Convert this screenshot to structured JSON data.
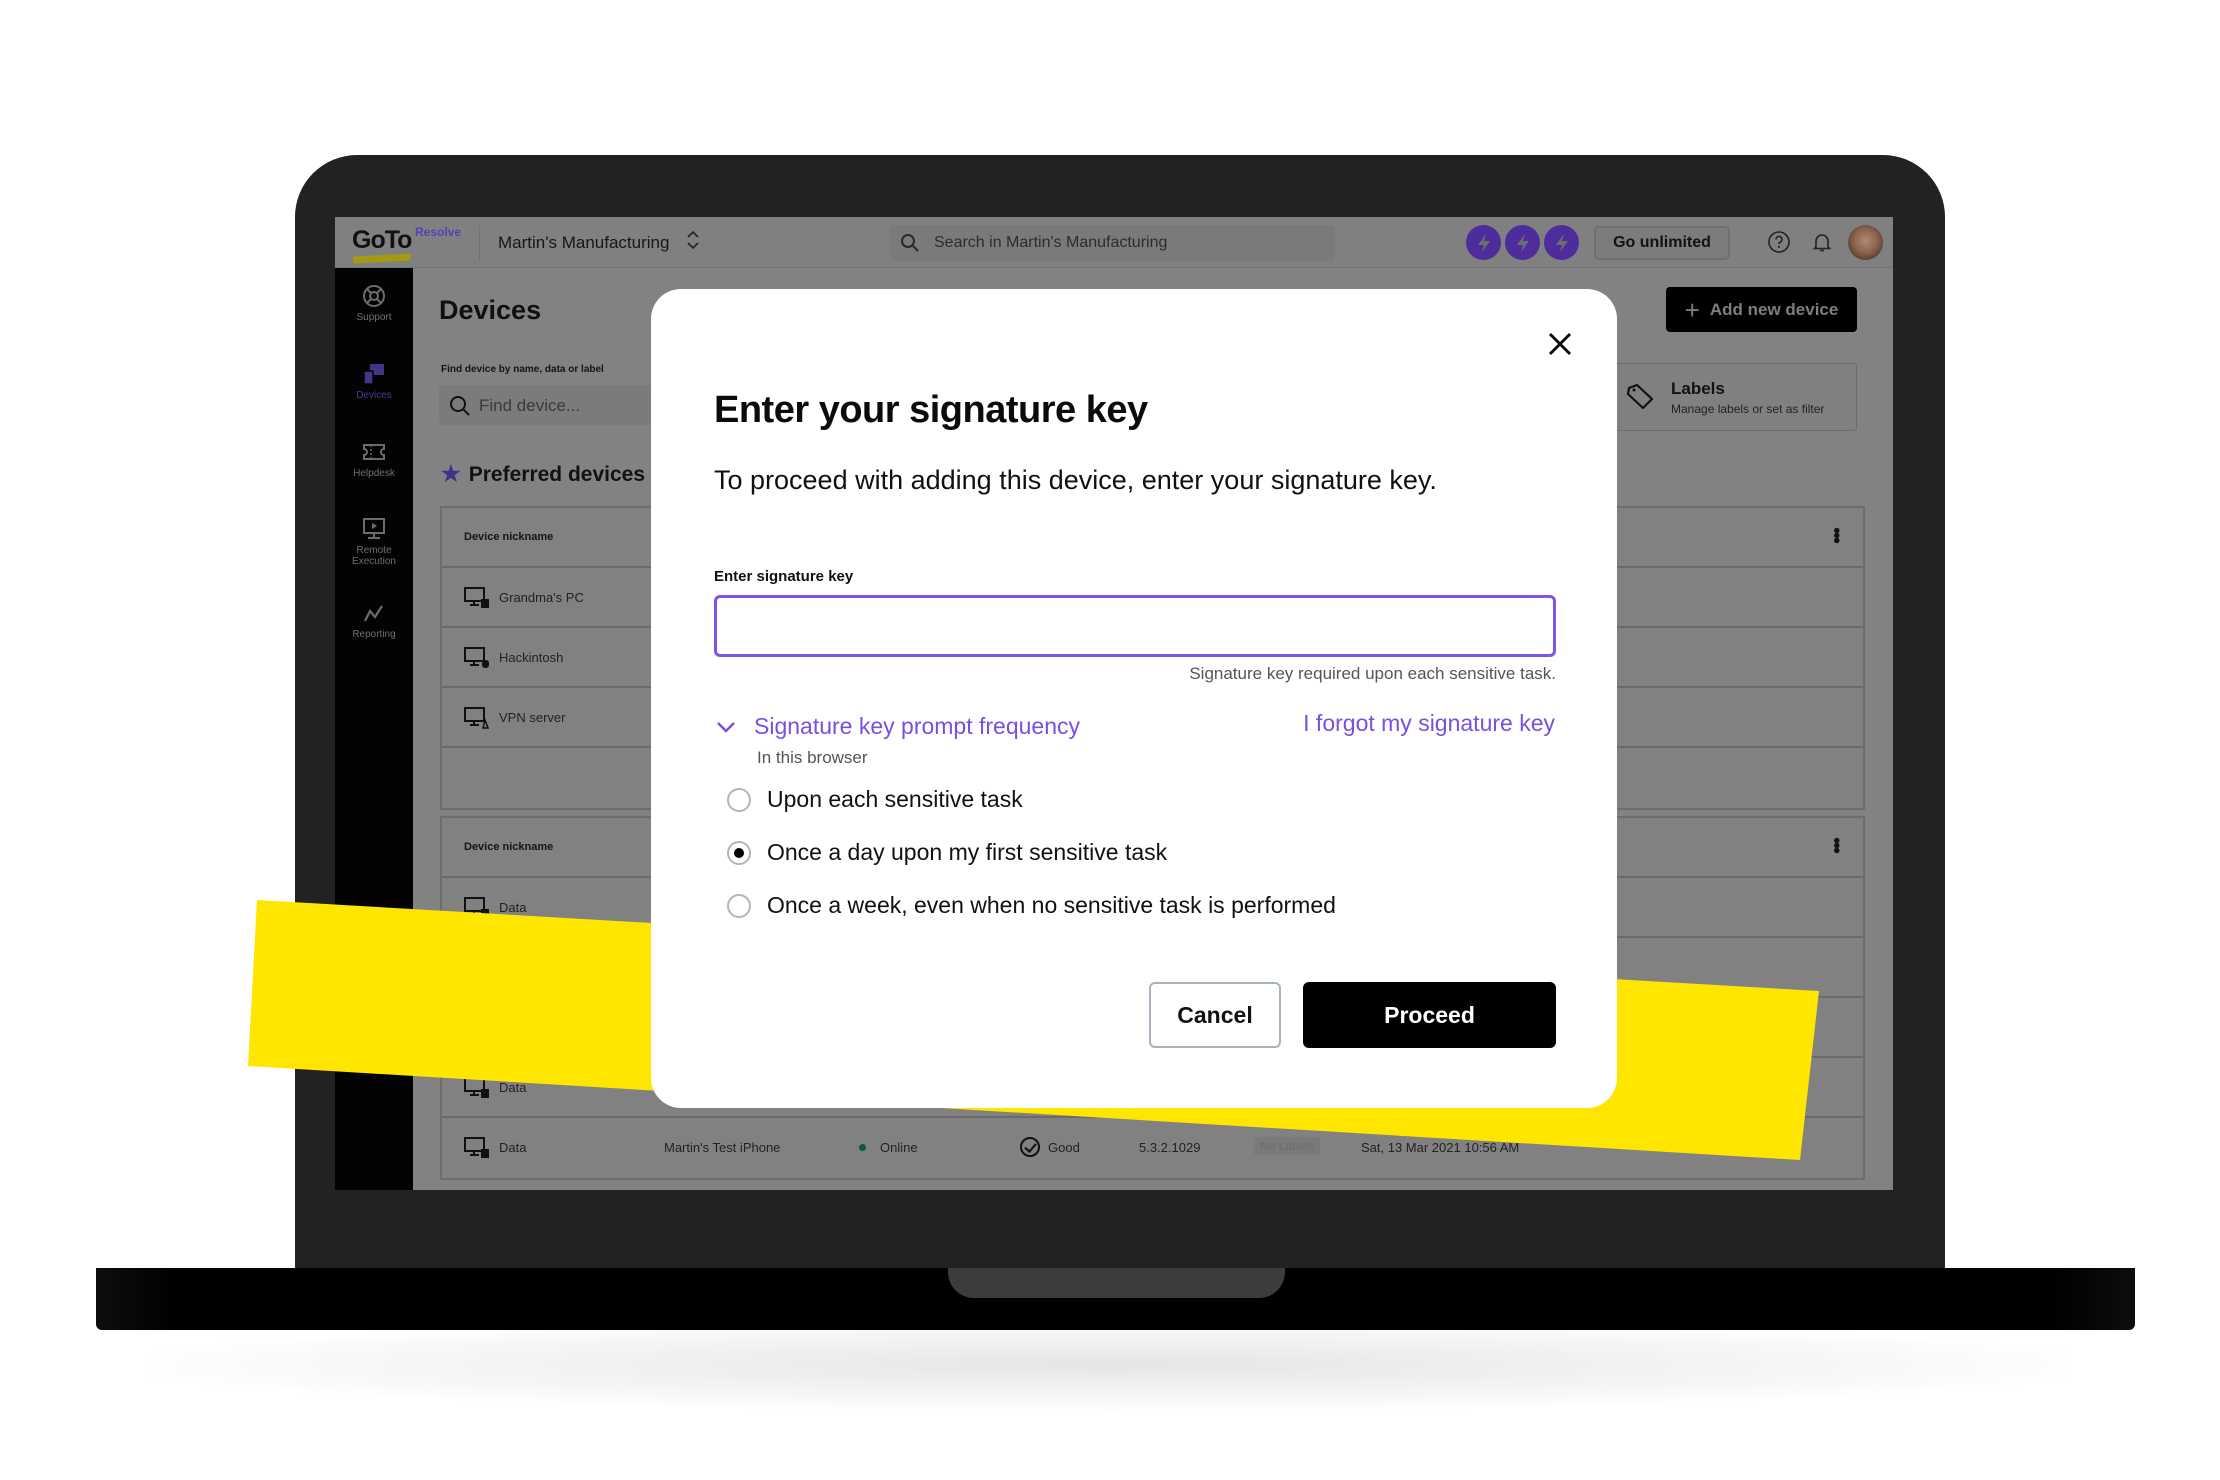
{
  "topbar": {
    "logo": "GoTo",
    "logo_sub": "Resolve",
    "org_name": "Martin's Manufacturing",
    "search_placeholder": "Search in Martin's Manufacturing",
    "go_unlimited": "Go unlimited",
    "brand_purple": "#4e2c9b"
  },
  "sidebar": {
    "items": [
      {
        "label": "Support",
        "icon": "lifebuoy-icon"
      },
      {
        "label": "Devices",
        "icon": "devices-icon",
        "active": true
      },
      {
        "label": "Helpdesk",
        "icon": "ticket-icon"
      },
      {
        "label": "Remote Execution",
        "icon": "monitor-play-icon"
      },
      {
        "label": "Reporting",
        "icon": "chart-line-icon"
      }
    ]
  },
  "main": {
    "title": "Devices",
    "find_label": "Find device by name, data or label",
    "find_placeholder": "Find device...",
    "preferred_title": "Preferred devices",
    "add_button": "Add new device",
    "labels_card": {
      "title": "Labels",
      "subtitle": "Manage labels or set as filter"
    },
    "table1": {
      "header": "Device nickname",
      "rows": [
        {
          "name": "Grandma's PC"
        },
        {
          "name": "Hackintosh"
        },
        {
          "name": "VPN server"
        }
      ]
    },
    "table2": {
      "header": "Device nickname",
      "rows": [
        {
          "name": "Data"
        },
        {
          "name": ""
        },
        {
          "name": ""
        },
        {
          "name": "Data"
        },
        {
          "name": "Data",
          "description": "Martin's Test iPhone",
          "status": "Online",
          "health": "Good",
          "version": "5.3.2.1029",
          "labels": "No Labels",
          "last_seen": "Sat, 13 Mar 2021 10:56 AM"
        }
      ]
    }
  },
  "modal": {
    "title": "Enter your signature key",
    "subtitle": "To proceed with adding this device, enter your signature key.",
    "input_label": "Enter signature key",
    "input_value": "",
    "hint": "Signature key required upon each sensitive task.",
    "frequency_label": "Signature key prompt frequency",
    "frequency_sub": "In this browser",
    "forgot_link": "I forgot my signature key",
    "options": [
      {
        "label": "Upon each sensitive task",
        "selected": false
      },
      {
        "label": "Once a day upon my first sensitive task",
        "selected": true
      },
      {
        "label": "Once a week, even when no sensitive task is performed",
        "selected": false
      }
    ],
    "cancel": "Cancel",
    "proceed": "Proceed",
    "accent": "#7a4fe0"
  },
  "decor": {
    "highlight_color": "#ffe600"
  }
}
